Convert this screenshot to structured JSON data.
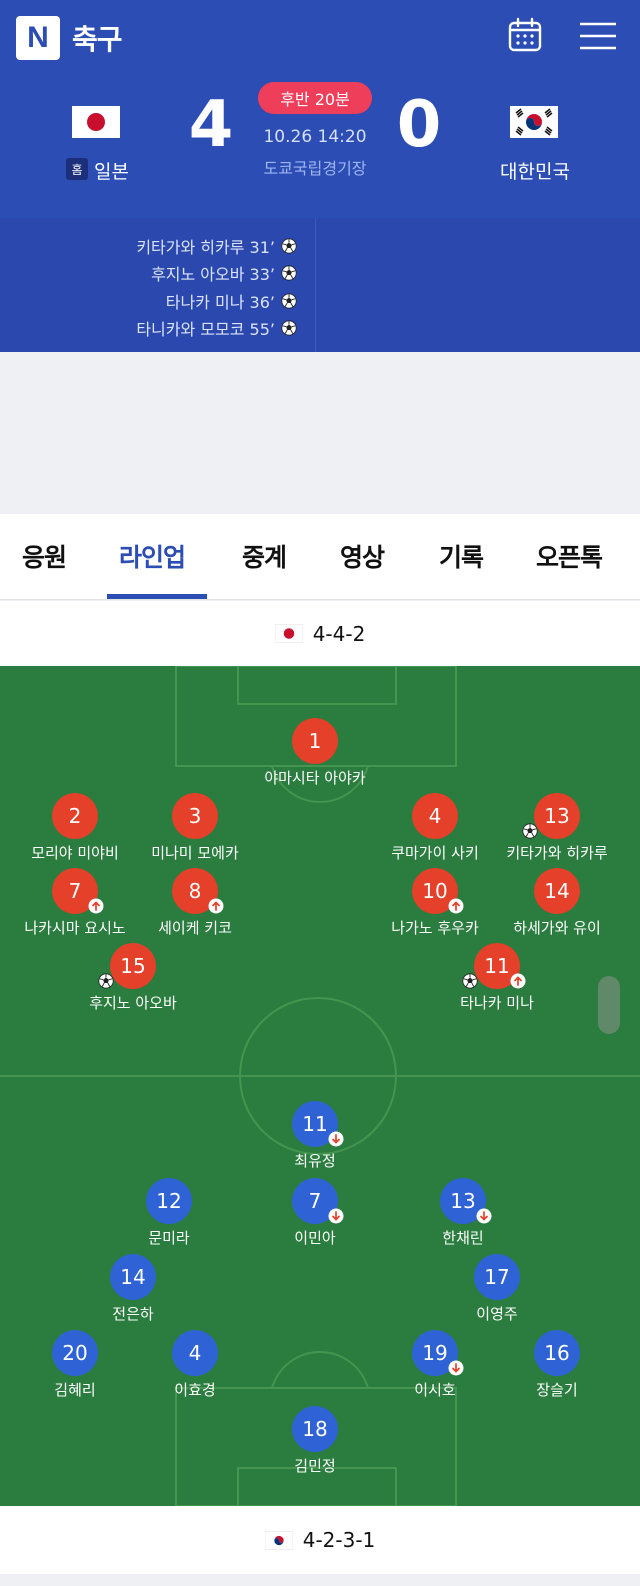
{
  "header": {
    "logo": "N",
    "title": "축구",
    "calendar_icon": "calendar-icon",
    "menu_icon": "hamburger-menu-icon"
  },
  "match": {
    "status": "후반 20분",
    "datetime": "10.26 14:20",
    "venue": "도쿄국립경기장",
    "home": {
      "badge": "홈",
      "name": "일본",
      "score": "4"
    },
    "away": {
      "name": "대한민국",
      "score": "0"
    },
    "scorers": [
      {
        "text": "키타가와 히카루 31’"
      },
      {
        "text": "후지노 아오바 33’"
      },
      {
        "text": "타나카 미나 36’"
      },
      {
        "text": "타니카와 모모코 55’"
      }
    ]
  },
  "tabs": [
    "응원",
    "라인업",
    "중계",
    "영상",
    "기록",
    "오픈톡"
  ],
  "active_tab": "라인업",
  "lineup": {
    "home_formation": "4-4-2",
    "away_formation": "4-2-3-1",
    "home_players": [
      {
        "number": "1",
        "name": "야마시타 아야카"
      },
      {
        "number": "2",
        "name": "모리야 미야비"
      },
      {
        "number": "3",
        "name": "미나미 모에카"
      },
      {
        "number": "4",
        "name": "쿠마가이 사키"
      },
      {
        "number": "13",
        "name": "키타가와 히카루",
        "event": "goal"
      },
      {
        "number": "7",
        "name": "나카시마 요시노",
        "event": "sub-in"
      },
      {
        "number": "8",
        "name": "세이케 키코",
        "event": "sub-in"
      },
      {
        "number": "10",
        "name": "나가노 후우카",
        "event": "sub-in"
      },
      {
        "number": "14",
        "name": "하세가와 유이"
      },
      {
        "number": "15",
        "name": "후지노 아오바",
        "event": "goal"
      },
      {
        "number": "11",
        "name": "타나카 미나",
        "event": "goal-sub-in"
      }
    ],
    "away_players": [
      {
        "number": "11",
        "name": "최유정",
        "event": "sub-out"
      },
      {
        "number": "12",
        "name": "문미라"
      },
      {
        "number": "7",
        "name": "이민아",
        "event": "sub-out"
      },
      {
        "number": "13",
        "name": "한채린",
        "event": "sub-out"
      },
      {
        "number": "14",
        "name": "전은하"
      },
      {
        "number": "17",
        "name": "이영주"
      },
      {
        "number": "20",
        "name": "김혜리"
      },
      {
        "number": "4",
        "name": "이효경"
      },
      {
        "number": "19",
        "name": "이시호",
        "event": "sub-out"
      },
      {
        "number": "16",
        "name": "장슬기"
      },
      {
        "number": "18",
        "name": "김민정"
      }
    ]
  },
  "colors": {
    "header_blue": "#2b4db4",
    "pitch_green": "#2a7d3e",
    "home_disc": "#e4402a",
    "away_disc": "#2f63d5",
    "status_pill": "#ef3e5a"
  }
}
